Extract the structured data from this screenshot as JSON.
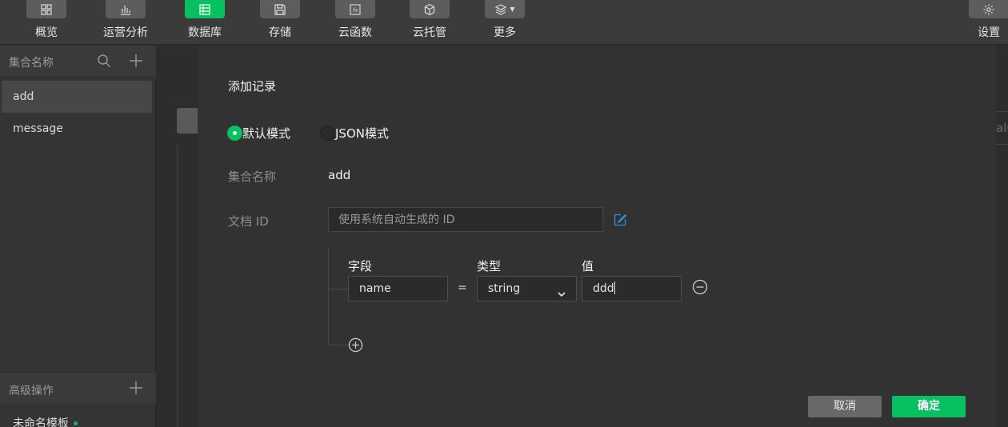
{
  "toolbar": {
    "items": [
      {
        "label": "概览",
        "icon": "grid-icon",
        "active": false
      },
      {
        "label": "运营分析",
        "icon": "bar-chart-icon",
        "active": false
      },
      {
        "label": "数据库",
        "icon": "database-icon",
        "active": true
      },
      {
        "label": "存储",
        "icon": "save-icon",
        "active": false
      },
      {
        "label": "云函数",
        "icon": "function-icon",
        "active": false
      },
      {
        "label": "云托管",
        "icon": "cube-icon",
        "active": false
      },
      {
        "label": "更多",
        "icon": "layers-icon",
        "active": false
      }
    ],
    "settings_label": "设置"
  },
  "sidebar": {
    "title": "集合名称",
    "collections": [
      "add",
      "message"
    ],
    "selected": "add",
    "advanced_title": "高级操作",
    "template_item": "未命名模板"
  },
  "background": {
    "right_snippet": "alu"
  },
  "dialog": {
    "title": "添加记录",
    "modes": [
      "默认模式",
      "JSON模式"
    ],
    "selected_mode": "默认模式",
    "collection_label": "集合名称",
    "collection_value": "add",
    "docid_label": "文档 ID",
    "docid_placeholder": "使用系统自动生成的 ID",
    "headers": {
      "field": "字段",
      "type": "类型",
      "value": "值"
    },
    "row": {
      "field": "name",
      "operator": "=",
      "type": "string",
      "value": "ddd"
    },
    "cancel_label": "取消",
    "ok_label": "确定"
  },
  "colors": {
    "accent": "#07c160",
    "link_icon": "#2e8ed8"
  }
}
